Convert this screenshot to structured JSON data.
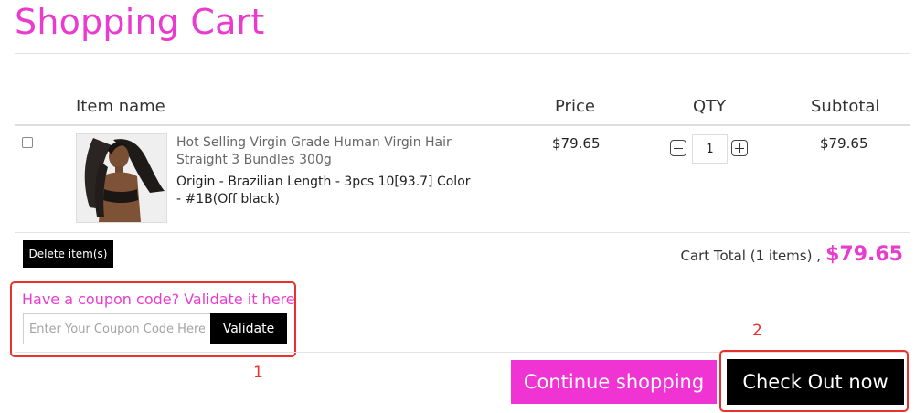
{
  "page": {
    "title": "Shopping Cart"
  },
  "table": {
    "headers": {
      "item_name": "Item name",
      "price": "Price",
      "qty": "QTY",
      "subtotal": "Subtotal"
    },
    "rows": [
      {
        "selected": false,
        "name": "Hot Selling Virgin Grade Human Virgin Hair Straight 3 Bundles 300g",
        "attributes": "Origin - Brazilian Length - 3pcs 10[93.7] Color - #1B(Off black)",
        "price": "$79.65",
        "quantity": "1",
        "subtotal": "$79.65"
      }
    ]
  },
  "actions": {
    "delete_label": "Delete item(s)",
    "cart_total_label": "Cart Total (1 items) ,",
    "cart_total_amount": "$79.65"
  },
  "coupon": {
    "title": "Have a coupon code? Validate it here",
    "placeholder": "Enter Your Coupon Code Here",
    "validate_label": "Validate"
  },
  "annotations": {
    "box1": "1",
    "box2": "2"
  },
  "footer": {
    "continue_label": "Continue shopping",
    "checkout_label": "Check Out now"
  },
  "colors": {
    "accent": "#e93ccf",
    "annotation": "#e8332c",
    "button_dark": "#000000"
  },
  "icons": {
    "qty_minus": "minus-square-icon",
    "qty_plus": "plus-square-icon"
  }
}
